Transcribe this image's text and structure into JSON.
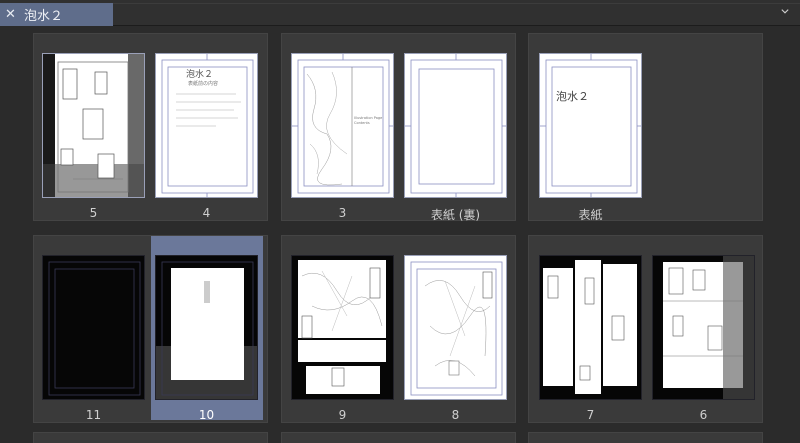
{
  "tab": {
    "title": "泡水２",
    "close_icon": "close-icon"
  },
  "menu_icon": "chevron-down-icon",
  "pages": {
    "p5": "5",
    "p4": "4",
    "p3": "3",
    "p_back_cover": "表紙 (裏)",
    "p_cover": "表紙",
    "p11": "11",
    "p10": "10",
    "p9": "9",
    "p8": "8",
    "p7": "7",
    "p6": "6"
  },
  "cover_title": "泡水２",
  "p4_title": "泡水２",
  "p4_subtitle": "表紙前の内容",
  "p3_caption": "Illustration Page Contents",
  "selected_page": "10"
}
